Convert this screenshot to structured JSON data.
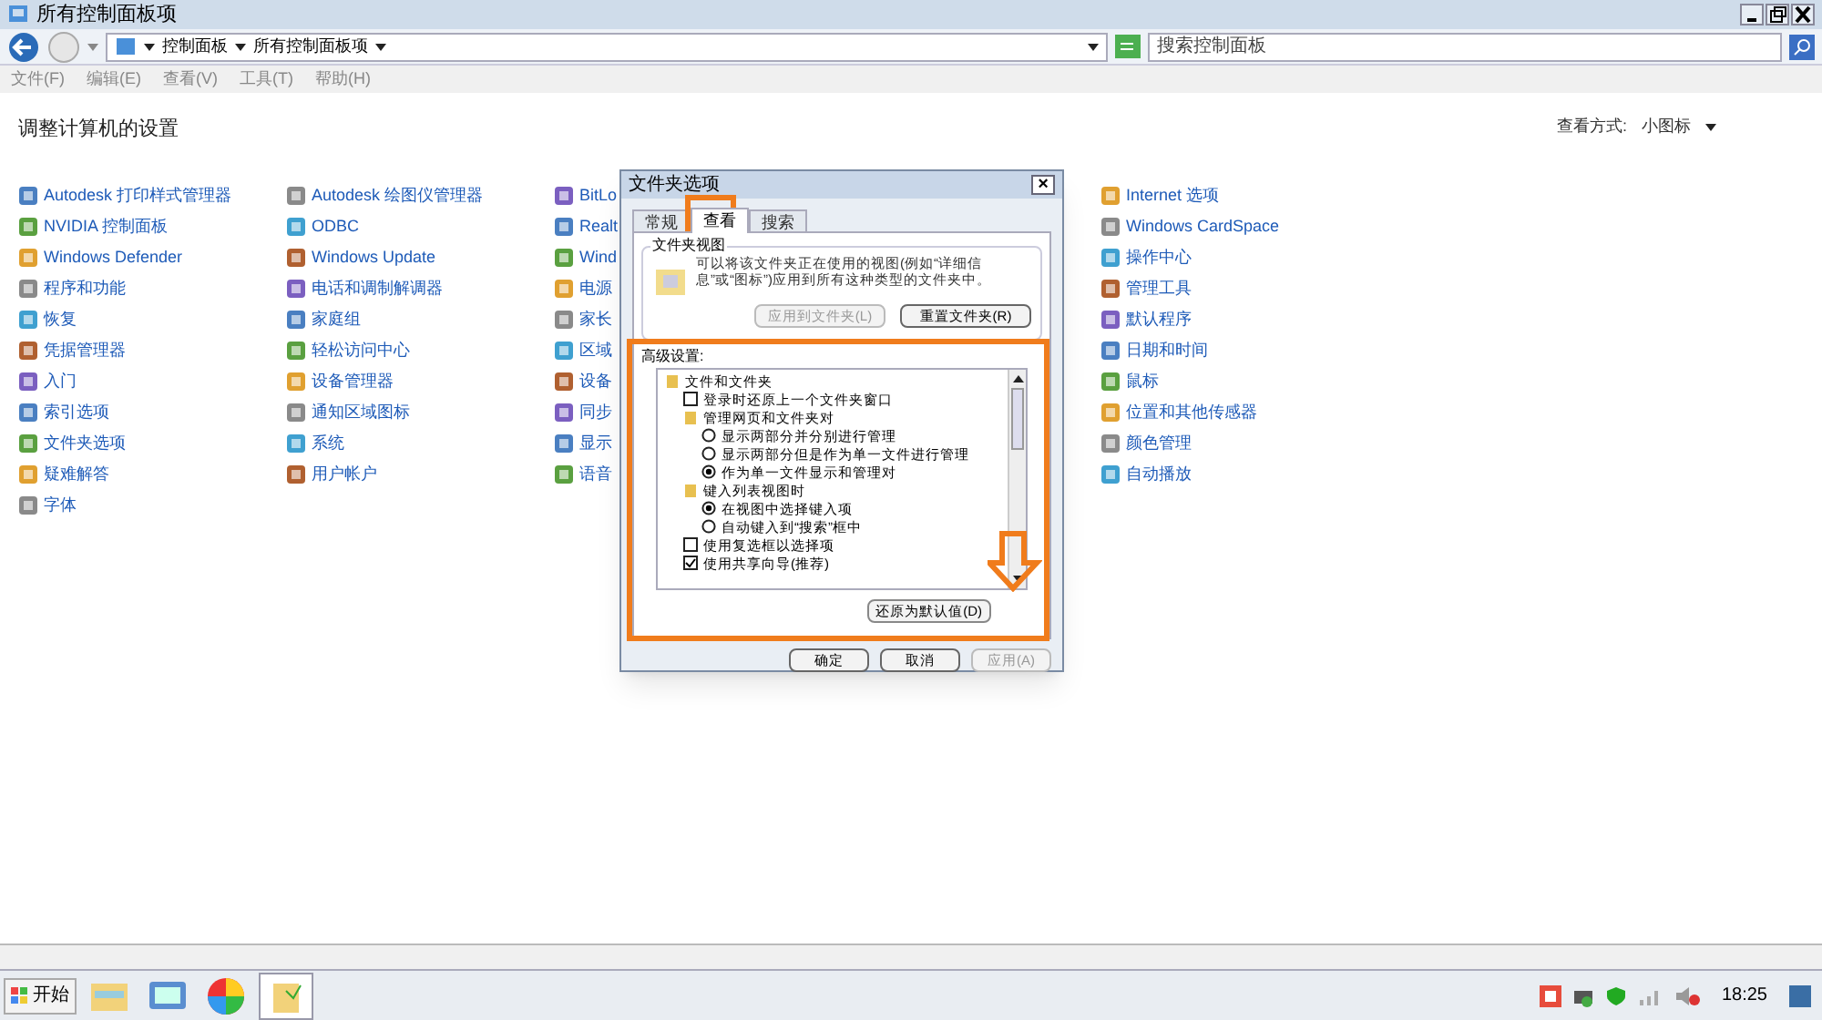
{
  "window": {
    "title": "所有控制面板项"
  },
  "address_bar": {
    "crumbs": [
      "控制面板",
      "所有控制面板项"
    ],
    "search": {
      "placeholder": "搜索控制面板"
    }
  },
  "menu": [
    "文件(F)",
    "编辑(E)",
    "查看(V)",
    "工具(T)",
    "帮助(H)"
  ],
  "heading": "调整计算机的设置",
  "view_by": {
    "label": "查看方式:",
    "value": "小图标"
  },
  "columns": [
    [
      "Autodesk 打印样式管理器",
      "NVIDIA 控制面板",
      "Windows Defender",
      "程序和功能",
      "恢复",
      "凭据管理器",
      "入门",
      "索引选项",
      "文件夹选项",
      "疑难解答",
      "字体"
    ],
    [
      "Autodesk 绘图仪管理器",
      "ODBC",
      "Windows Update",
      "电话和调制解调器",
      "家庭组",
      "轻松访问中心",
      "设备管理器",
      "通知区域图标",
      "系统",
      "用户帐户"
    ],
    [
      "BitLo",
      "Realt",
      "Wind",
      "电源",
      "家长",
      "区域",
      "设备",
      "同步",
      "显示",
      "语音"
    ],
    [
      "Internet 选项",
      "Windows CardSpace",
      "操作中心",
      "管理工具",
      "默认程序",
      "日期和时间",
      "鼠标",
      "位置和其他传感器",
      "颜色管理",
      "自动播放"
    ]
  ],
  "dialog": {
    "title": "文件夹选项",
    "close": "×",
    "tabs": [
      {
        "label": "常规",
        "selected": false
      },
      {
        "label": "查看",
        "selected": true
      },
      {
        "label": "搜索",
        "selected": false
      }
    ],
    "folder_views": {
      "title": "文件夹视图",
      "text": "可以将该文件夹正在使用的视图(例如“详细信息”或“图标”)应用到所有这种类型的文件夹中。",
      "buttons": [
        {
          "label": "应用到文件夹(L)",
          "disabled": true
        },
        {
          "label": "重置文件夹(R)",
          "disabled": false
        }
      ]
    },
    "advanced": {
      "label": "高级设置:",
      "tree": [
        {
          "kind": "folder",
          "label": "文件和文件夹",
          "children": [
            {
              "kind": "checkbox",
              "label": "登录时还原上一个文件夹窗口",
              "checked": false
            },
            {
              "kind": "folder",
              "label": "管理网页和文件夹对",
              "children": [
                {
                  "kind": "radio",
                  "label": "显示两部分并分别进行管理",
                  "checked": false
                },
                {
                  "kind": "radio",
                  "label": "显示两部分但是作为单一文件进行管理",
                  "checked": false
                },
                {
                  "kind": "radio",
                  "label": "作为单一文件显示和管理对",
                  "checked": true
                }
              ]
            },
            {
              "kind": "folder",
              "label": "键入列表视图时",
              "children": [
                {
                  "kind": "radio",
                  "label": "在视图中选择键入项",
                  "checked": true
                },
                {
                  "kind": "radio",
                  "label": "自动键入到“搜索”框中",
                  "checked": false
                }
              ]
            },
            {
              "kind": "checkbox",
              "label": "使用复选框以选择项",
              "checked": false
            },
            {
              "kind": "checkbox",
              "label": "使用共享向导(推荐)",
              "checked": true
            }
          ]
        }
      ],
      "restore": "还原为默认值(D)"
    },
    "buttons": [
      {
        "label": "确定",
        "disabled": false
      },
      {
        "label": "取消",
        "disabled": false
      },
      {
        "label": "应用(A)",
        "disabled": true
      }
    ]
  },
  "taskbar": {
    "start": "开始",
    "clock": "18:25"
  }
}
